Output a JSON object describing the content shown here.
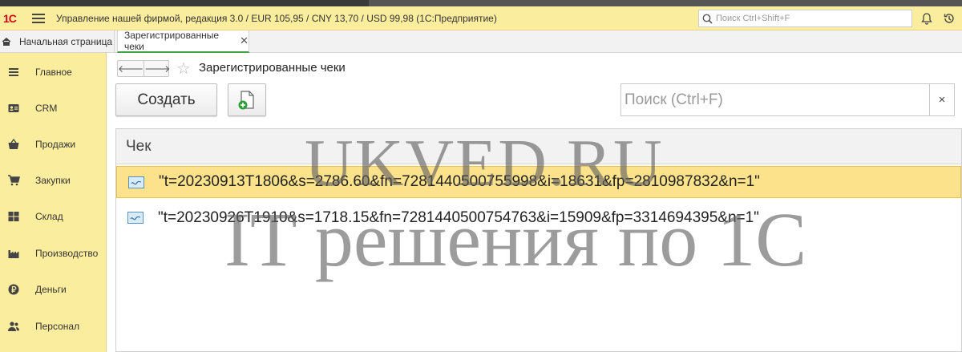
{
  "window": {
    "logo_text": "1С",
    "app_title": "Управление нашей фирмой, редакция 3.0 / EUR 105,95 / CNY 13,70 / USD 99,98  (1С:Предприятие)",
    "global_search_placeholder": "Поиск Ctrl+Shift+F",
    "accent_color": "#fbed9e"
  },
  "tabs": [
    {
      "label": "Начальная страница",
      "active": false
    },
    {
      "label": "Зарегистрированные чеки",
      "active": true
    }
  ],
  "sidebar": {
    "items": [
      {
        "label": "Главное",
        "icon": "menu-lines-icon"
      },
      {
        "label": "CRM",
        "icon": "contact-card-icon"
      },
      {
        "label": "Продажи",
        "icon": "basket-icon"
      },
      {
        "label": "Закупки",
        "icon": "cart-icon"
      },
      {
        "label": "Склад",
        "icon": "warehouse-grid-icon"
      },
      {
        "label": "Производство",
        "icon": "factory-icon"
      },
      {
        "label": "Деньги",
        "icon": "ruble-coin-icon"
      },
      {
        "label": "Персонал",
        "icon": "people-icon"
      }
    ]
  },
  "form": {
    "title": "Зарегистрированные чеки",
    "create_label": "Создать",
    "search_placeholder": "Поиск (Ctrl+F)",
    "clear_label": "×"
  },
  "table": {
    "header": "Чек",
    "rows": [
      {
        "text": "\"t=20230913T1806&s=2786.60&fn=7281440500755998&i=18631&fp=2810987832&n=1\"",
        "selected": true
      },
      {
        "text": "\"t=20230926T1910&s=1718.15&fn=7281440500754763&i=15909&fp=3314694395&n=1\"",
        "selected": false
      }
    ]
  },
  "watermark": {
    "line1": "UKVED.RU",
    "line2": "IT решения по 1С"
  },
  "colors": {
    "selected_row": "#fbe28b",
    "selected_border": "#ecc34a",
    "tab_underline": "#43a047"
  }
}
